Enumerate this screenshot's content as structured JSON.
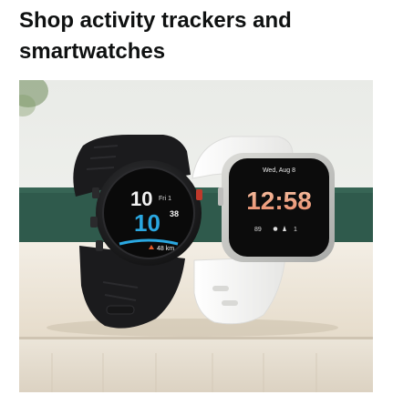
{
  "card": {
    "title": "Shop activity trackers and smartwatches"
  },
  "hero": {
    "garmin": {
      "hour": "10",
      "day": "Fri 1",
      "minute": "10",
      "seconds": "38",
      "distance": "48 km"
    },
    "versa": {
      "date": "Wed, Aug 8",
      "time": "12:58",
      "stat_left": "89",
      "stat_right": "1"
    }
  },
  "colors": {
    "title": "#0f1111",
    "garmin_accent": "#2aa7e0",
    "garmin_body": "#1c1c1e",
    "versa_band": "#f4f4f2",
    "versa_digits": "#f0a88a",
    "wall": "#f2f2ef",
    "green_stripe": "#2f5a4c",
    "table": "#efe8dc"
  }
}
